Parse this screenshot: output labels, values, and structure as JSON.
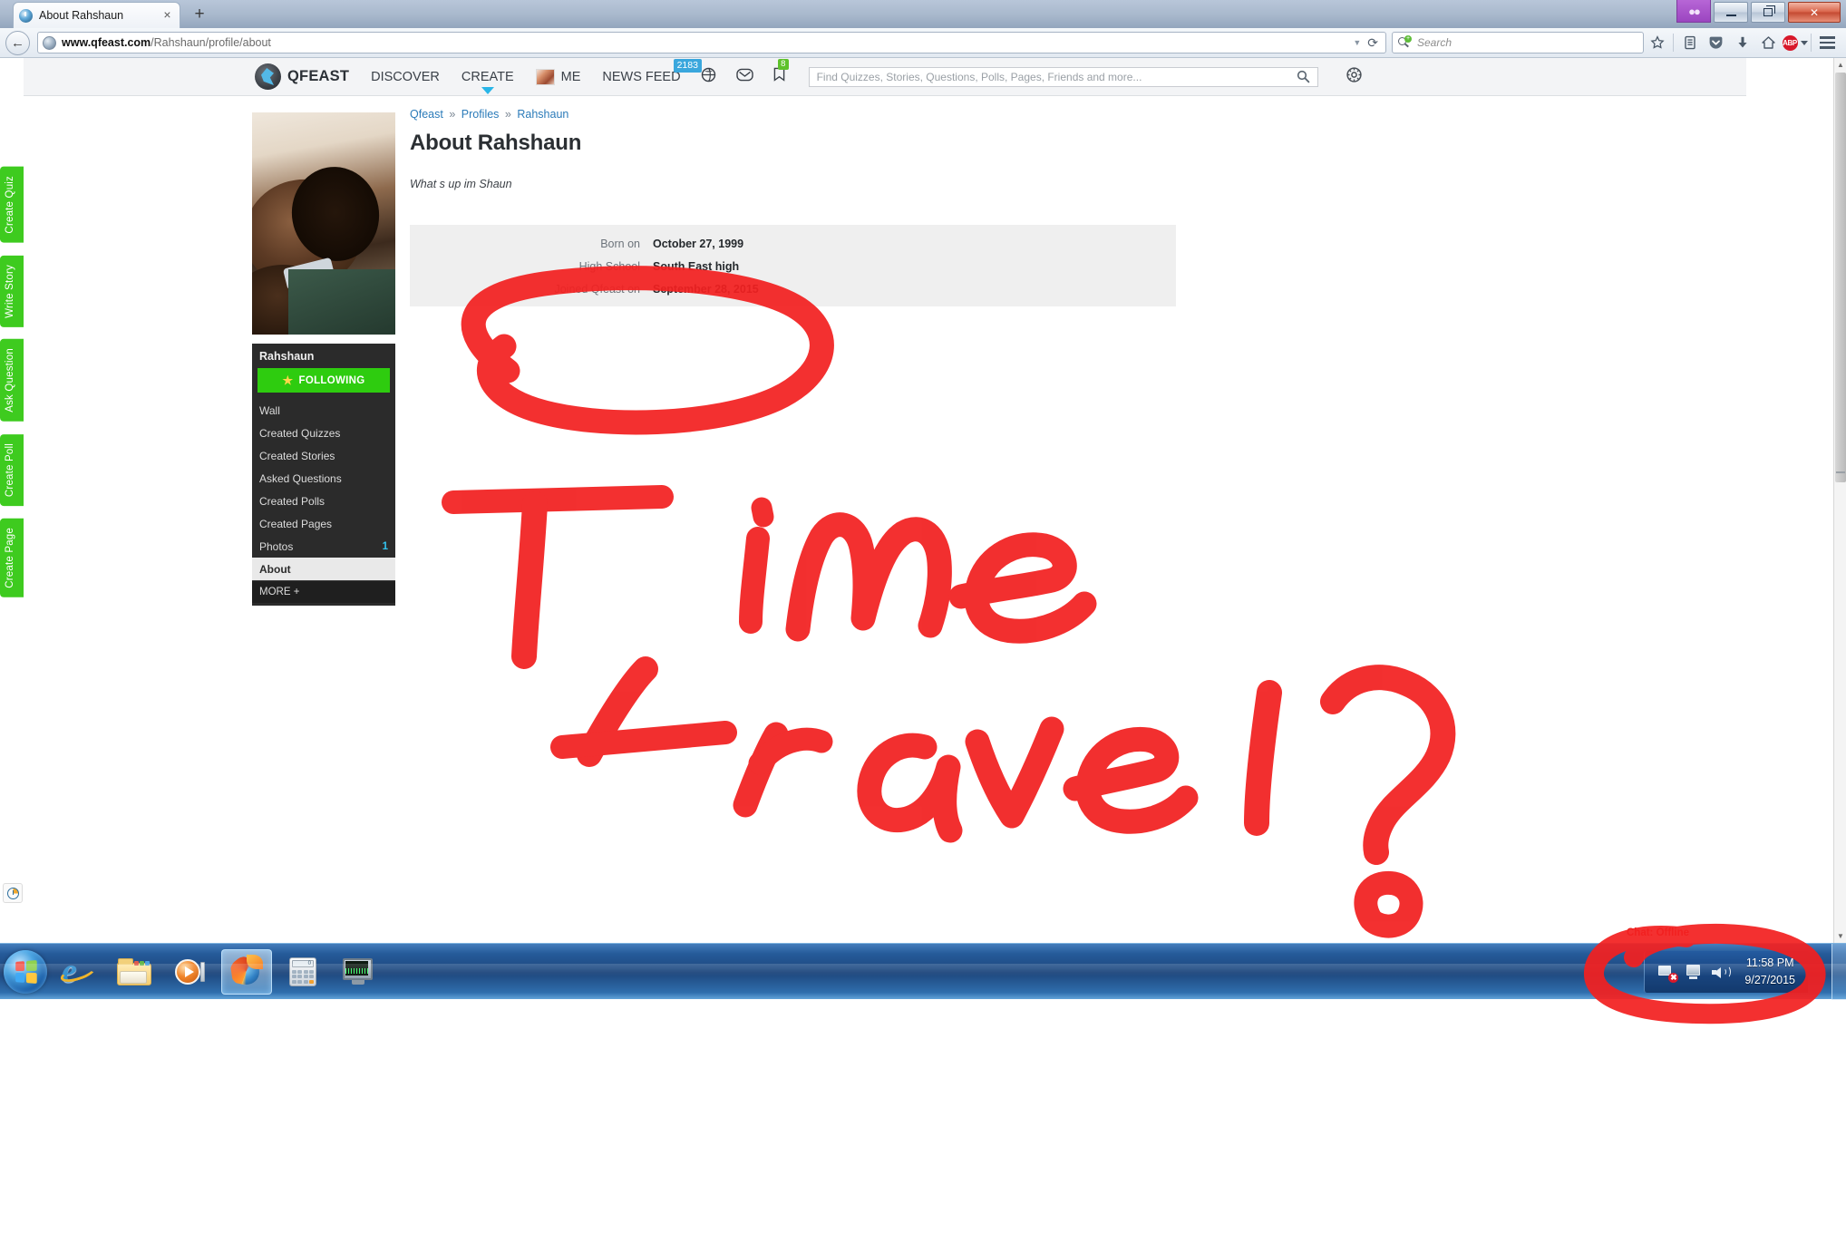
{
  "browser": {
    "tab": {
      "title": "About Rahshaun",
      "close_label": "×",
      "favicon": "qfeast-favicon"
    },
    "newtab_label": "+",
    "window_controls": {
      "private_label": "private-browsing-mask",
      "minimize": "–",
      "restore": "❐",
      "close": "✕"
    },
    "back_label": "←",
    "url": {
      "scheme_host": "www.qfeast.com",
      "path": "/Rahshaun/profile/about"
    },
    "url_dropdown": "▼",
    "reload_label": "⟳",
    "search": {
      "placeholder": "Search",
      "engine_icon": "qfeast-search-icon"
    },
    "toolbar_icons": [
      {
        "name": "bookmark-star-icon",
        "glyph": "☆"
      },
      {
        "name": "reading-list-icon",
        "glyph": "὜b"
      },
      {
        "name": "pocket-icon",
        "glyph": "▼"
      },
      {
        "name": "download-icon",
        "glyph": "⬇"
      },
      {
        "name": "home-icon",
        "glyph": "⌂"
      },
      {
        "name": "adblock-plus-icon",
        "glyph": "ABP"
      }
    ],
    "menu_label": "open-menu"
  },
  "page": {
    "left_action_tabs": [
      {
        "label": "Create Quiz"
      },
      {
        "label": "Write Story"
      },
      {
        "label": "Ask Question"
      },
      {
        "label": "Create Poll"
      },
      {
        "label": "Create Page"
      }
    ],
    "site_header": {
      "brand": "QFEAST",
      "nav": [
        {
          "label": "DISCOVER",
          "has_caret": false
        },
        {
          "label": "CREATE",
          "has_caret": true
        }
      ],
      "me_label": "ME",
      "news_feed": {
        "label": "NEWS FEED",
        "badge": "2183"
      },
      "icons": [
        {
          "name": "globe-icon",
          "badge": ""
        },
        {
          "name": "messages-envelope-icon",
          "badge": ""
        },
        {
          "name": "bookmarks-icon",
          "badge": "8"
        }
      ],
      "search_placeholder": "Find Quizzes, Stories, Questions, Polls, Pages, Friends and more...",
      "settings_label": "settings-gear"
    },
    "breadcrumb": {
      "items": [
        "Qfeast",
        "Profiles",
        "Rahshaun"
      ],
      "separator": "»"
    },
    "title": "About Rahshaun",
    "bio": "What s up im Shaun",
    "info_rows": [
      {
        "label": "Born on",
        "value": "October 27, 1999"
      },
      {
        "label": "High School",
        "value": "South East high"
      },
      {
        "label": "Joined Qfeast on",
        "value": "September 28, 2015"
      }
    ],
    "sidebar": {
      "username": "Rahshaun",
      "follow_button": "FOLLOWING",
      "links": [
        {
          "label": "Wall",
          "count": ""
        },
        {
          "label": "Created Quizzes",
          "count": ""
        },
        {
          "label": "Created Stories",
          "count": ""
        },
        {
          "label": "Asked Questions",
          "count": ""
        },
        {
          "label": "Created Polls",
          "count": ""
        },
        {
          "label": "Created Pages",
          "count": ""
        },
        {
          "label": "Photos",
          "count": "1"
        },
        {
          "label": "About",
          "count": "",
          "active": true
        }
      ],
      "more_label": "MORE +"
    },
    "bottom_left_tool": "clock-history-icon"
  },
  "annotations": {
    "handwriting": "Time travel?",
    "accent_color": "#f22020",
    "circled_targets": [
      "joined-qfeast-row",
      "system-clock"
    ]
  },
  "taskbar": {
    "start_label": "Start",
    "items": [
      {
        "name": "internet-explorer",
        "active": false
      },
      {
        "name": "windows-explorer",
        "active": false
      },
      {
        "name": "windows-media-player",
        "active": false
      },
      {
        "name": "firefox",
        "active": true
      },
      {
        "name": "calculator",
        "active": false
      },
      {
        "name": "system-monitor",
        "active": false
      }
    ],
    "tray": [
      {
        "name": "network-error-icon"
      },
      {
        "name": "remote-desktop-icon"
      },
      {
        "name": "volume-icon"
      }
    ],
    "clock": {
      "time": "11:58 PM",
      "date": "9/27/2015"
    },
    "chat_status": "Chat: Offline"
  }
}
